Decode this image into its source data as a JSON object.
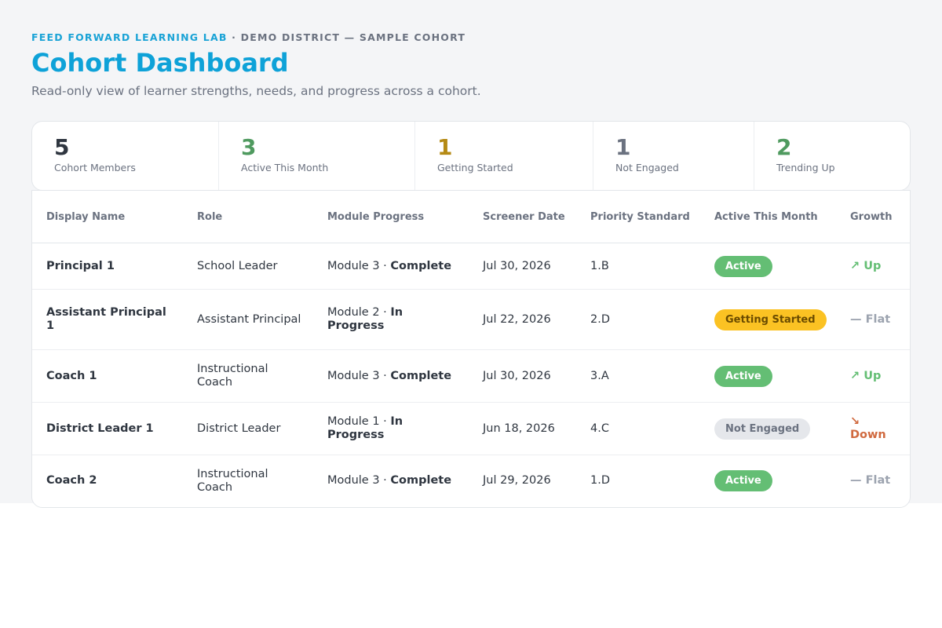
{
  "header": {
    "brand": "FEED FORWARD LEARNING LAB",
    "separator": "·",
    "district": "DEMO DISTRICT — SAMPLE COHORT",
    "title": "Cohort Dashboard",
    "subtitle": "Read-only view of learner strengths, needs, and progress across a cohort."
  },
  "stats": [
    {
      "value": "5",
      "label": "Cohort Members"
    },
    {
      "value": "3",
      "label": "Active This Month"
    },
    {
      "value": "1",
      "label": "Getting Started"
    },
    {
      "value": "1",
      "label": "Not Engaged"
    },
    {
      "value": "2",
      "label": "Trending Up"
    }
  ],
  "table": {
    "columns": [
      "Display Name",
      "Role",
      "Module Progress",
      "Screener Date",
      "Priority Standard",
      "Active This Month",
      "Growth"
    ],
    "rows": [
      {
        "name": "Principal 1",
        "role": "School Leader",
        "module": "Module 3",
        "module_sep": "·",
        "module_status": "Complete",
        "date": "Jul 30, 2026",
        "standard": "1.B",
        "active": "Active",
        "growth_icon": "↗",
        "growth": "Up"
      },
      {
        "name": "Assistant Principal 1",
        "role": "Assistant Principal",
        "module": "Module 2",
        "module_sep": "·",
        "module_status": "In Progress",
        "date": "Jul 22, 2026",
        "standard": "2.D",
        "active": "Getting Started",
        "growth_icon": "—",
        "growth": "Flat"
      },
      {
        "name": "Coach 1",
        "role": "Instructional Coach",
        "module": "Module 3",
        "module_sep": "·",
        "module_status": "Complete",
        "date": "Jul 30, 2026",
        "standard": "3.A",
        "active": "Active",
        "growth_icon": "↗",
        "growth": "Up"
      },
      {
        "name": "District Leader 1",
        "role": "District Leader",
        "module": "Module 1",
        "module_sep": "·",
        "module_status": "In Progress",
        "date": "Jun 18, 2026",
        "standard": "4.C",
        "active": "Not Engaged",
        "growth_icon": "↘",
        "growth": "Down"
      },
      {
        "name": "Coach 2",
        "role": "Instructional Coach",
        "module": "Module 3",
        "module_sep": "·",
        "module_status": "Complete",
        "date": "Jul 29, 2026",
        "standard": "1.D",
        "active": "Active",
        "growth_icon": "—",
        "growth": "Flat"
      }
    ]
  },
  "colors": {
    "brand": "#0ea2d8",
    "active": "#64be74",
    "getting_started": "#fbc223",
    "not_engaged": "#e5e7eb",
    "growth_up": "#64be74",
    "growth_flat": "#9ca3af",
    "growth_down": "#d0693e"
  }
}
